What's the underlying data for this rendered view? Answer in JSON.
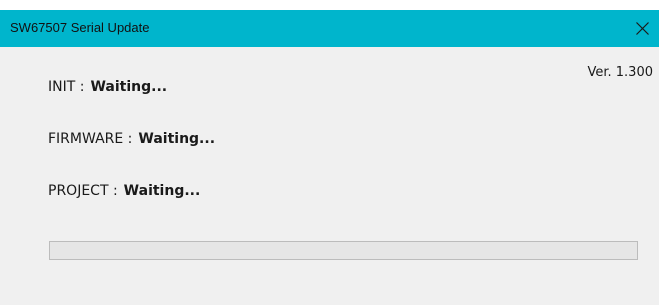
{
  "window": {
    "title": "SW67507 Serial Update",
    "title_bar_color": "#00b5cc"
  },
  "version": "Ver. 1.300",
  "status": {
    "init": {
      "label": "INIT :",
      "value": "Waiting..."
    },
    "firmware": {
      "label": "FIRMWARE :",
      "value": "Waiting..."
    },
    "project": {
      "label": "PROJECT :",
      "value": "Waiting..."
    }
  },
  "progress": {
    "percent": 0
  },
  "icons": {
    "close": "close-icon"
  }
}
